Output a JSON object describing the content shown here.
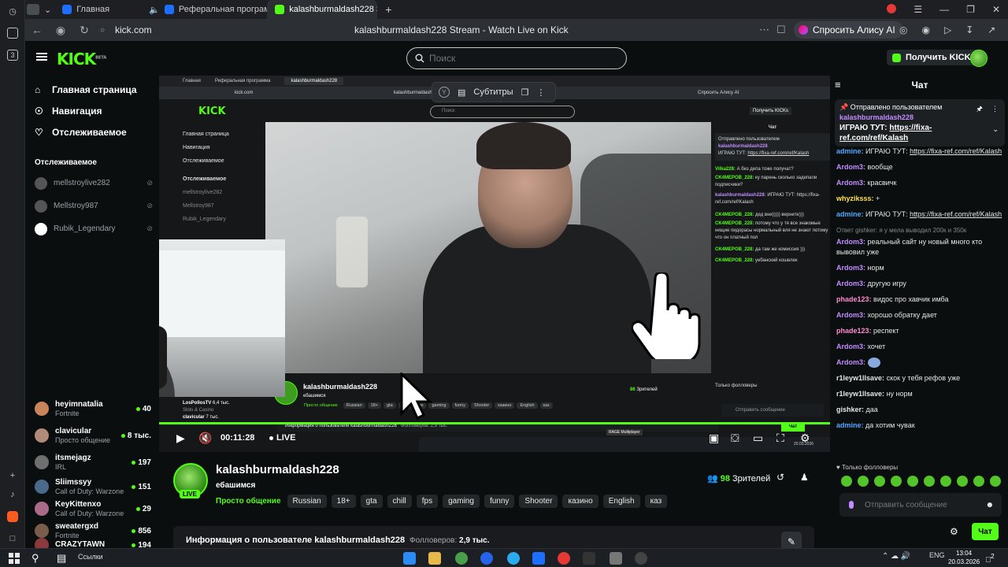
{
  "browser": {
    "tabs": [
      {
        "label": "Главная",
        "color": "#1e6fff"
      },
      {
        "label": "Реферальная программа",
        "color": "#1e6fff"
      },
      {
        "label": "kalashburmaldash228 S",
        "color": "#53fc18"
      }
    ],
    "url": "kick.com",
    "page_title": "kalashburmaldash228 Stream - Watch Live on Kick",
    "alice_label": "Спросить Алису AI",
    "rail_badge": "3"
  },
  "kick": {
    "logo": "KICK",
    "logo_sup": "BETA",
    "search_placeholder": "Поиск",
    "get_kicks": "Получить KICKs",
    "accent": "#53fc18"
  },
  "sidebar": {
    "links": [
      {
        "label": "Главная страница",
        "icon": "home-icon"
      },
      {
        "label": "Навигация",
        "icon": "compass-icon"
      },
      {
        "label": "Отслеживаемое",
        "icon": "heart-icon"
      }
    ],
    "followed_heading": "Отслеживаемое",
    "offline": [
      {
        "name": "mellstroylive282"
      },
      {
        "name": "Mellstroy987"
      },
      {
        "name": "Rubik_Legendary"
      }
    ],
    "live": [
      {
        "name": "heyimnatalia",
        "category": "Fortnite",
        "viewers": "40",
        "color": "#c9845b"
      },
      {
        "name": "clavicular",
        "category": "Просто общение",
        "viewers": "8 тыс.",
        "color": "#b08b77"
      },
      {
        "name": "itsmejagz",
        "category": "IRL",
        "viewers": "197",
        "color": "#6f6f6f"
      },
      {
        "name": "Sliimssyy",
        "category": "Call of Duty: Warzone",
        "viewers": "151",
        "color": "#4a6a8a"
      },
      {
        "name": "KeyKittenxo",
        "category": "Call of Duty: Warzone",
        "viewers": "29",
        "color": "#aa6b8b"
      },
      {
        "name": "sweatergxd",
        "category": "Fortnite",
        "viewers": "856",
        "color": "#7a5c4a"
      },
      {
        "name": "CRAZYTAWN",
        "category": "",
        "viewers": "194",
        "color": "#8a3a3a"
      }
    ]
  },
  "player": {
    "subtitles_label": "Субтитры",
    "timecode": "00:11:28",
    "live_label": "LIVE",
    "progress": 1.0
  },
  "inner": {
    "tabs": [
      "Главная",
      "Реферальная программа",
      "kalashburmaldash228"
    ],
    "url": "kick.com",
    "title": "kalashburmaldash228",
    "alice": "Спросить Алису AI",
    "search": "Поиск",
    "kicks": "Получить KICKs",
    "side": [
      "Главная страница",
      "Навигация",
      "Отслеживаемое"
    ],
    "side_heading": "Отслеживаемое",
    "side_ch": [
      "mellstroylive282",
      "Mellstroy987",
      "Rubik_Legendary"
    ],
    "side_live": [
      "LosPollosTV",
      "clavicular"
    ],
    "side_live_cat": "Slots & Casino",
    "side_live_views": [
      "6,4 тыс.",
      "7 тыс."
    ],
    "chat_title": "Чат",
    "pin_heading": "Отправлено пользователем",
    "pin_user": "kalashburmaldash228",
    "pin_text": "ИГРАЮ ТУТ:",
    "pin_link": "https://fixa-ref.com/ref/Kalash",
    "chat": [
      {
        "user": "Vilka228:",
        "text": "А без депа тоже получат?"
      },
      {
        "user": "CK4MEPOB_228:",
        "text": "ку парень сколько задепали подписчики?"
      },
      {
        "user": "kalashburmaldash228:",
        "text": "ИГРАЮ ТУТ: https://fixa-ref.com/ref/Kalash"
      },
      {
        "user": "CK4MEPOB_228:",
        "text": "дед вни))))) верните)))"
      },
      {
        "user": "CK4MEPOB_228:",
        "text": "потому что у тя все знакомые нищие пидорасы нормальный вля не знают потому что он платный пол"
      },
      {
        "user": "CK4MEPOB_228:",
        "text": "да там же комиссия )))"
      },
      {
        "user": "CK4MEPOB_228:",
        "text": "уебанский кошелек"
      }
    ],
    "followers_only": "Только фолловеры",
    "send_placeholder": "Отправить сообщение",
    "channel": "kalashburmaldash228",
    "channel_sub": "ебашимся",
    "viewers": "86",
    "viewers_label": "Зрителей",
    "tags": [
      "Просто общение",
      "Russian",
      "18+",
      "gta",
      "chill",
      "fps",
      "gaming",
      "funny",
      "Shooter",
      "казино",
      "English",
      "каз"
    ],
    "about": "Информация о пользователе kalashburmaldash228",
    "followers": "Фолловеров: 2,9 тыс.",
    "chat_btn": "Чат",
    "rage": "RAGE Multiplayer",
    "date": "20.03.2026"
  },
  "channel": {
    "name": "kalashburmaldash228",
    "subtitle": "ебашимся",
    "live_badge": "LIVE",
    "category": "Просто общение",
    "tags": [
      "Russian",
      "18+",
      "gta",
      "chill",
      "fps",
      "gaming",
      "funny",
      "Shooter",
      "казино",
      "English",
      "каз"
    ],
    "viewers_count": "98",
    "viewers_label": "Зрителей",
    "about_title": "Информация о пользователе kalashburmaldash228",
    "followers_label": "Фолловеров:",
    "followers_value": "2,9 тыс."
  },
  "chat": {
    "title": "Чат",
    "pinned_heading": "Отправлено пользователем",
    "pinned_user": "kalashburmaldash228",
    "pinned_text": "ИГРАЮ ТУТ:",
    "pinned_link": "https://fixa-ref.com/ref/Kalash",
    "messages": [
      {
        "user": "admine:",
        "color": "#53a8ff",
        "text": "ИГРАЮ ТУТ:",
        "link": "https://fixa-ref.com/ref/Kalash"
      },
      {
        "user": "Ardom3:",
        "color": "#c18cff",
        "text": "вообще"
      },
      {
        "user": "Ardom3:",
        "color": "#c18cff",
        "text": "красвичк"
      },
      {
        "user": "whyziksss:",
        "color": "#ffe04a",
        "text": "+"
      },
      {
        "user": "admine:",
        "color": "#53a8ff",
        "text": "ИГРАЮ ТУТ:",
        "link": "https://fixa-ref.com/ref/Kalash"
      },
      {
        "reply": "Ответ gishker: я у мела выводил 200к и 350к"
      },
      {
        "user": "Ardom3:",
        "color": "#c18cff",
        "text": "реальный сайт ну новый много кто вывовил уже"
      },
      {
        "user": "Ardom3:",
        "color": "#c18cff",
        "text": "норм"
      },
      {
        "user": "Ardom3:",
        "color": "#c18cff",
        "text": "другую игру"
      },
      {
        "user": "phade123:",
        "color": "#ff8ad1",
        "text": "видос про хавчик имба"
      },
      {
        "user": "Ardom3:",
        "color": "#c18cff",
        "text": "хорошо обратку дает"
      },
      {
        "user": "phade123:",
        "color": "#ff8ad1",
        "text": "респект"
      },
      {
        "user": "Ardom3:",
        "color": "#c18cff",
        "text": "хочет"
      },
      {
        "user": "Ardom3:",
        "color": "#c18cff",
        "text": ""
      },
      {
        "user": "r1leyw1llsave:",
        "color": "#ffffff",
        "text": "скок у тебя рефов уже"
      },
      {
        "user": "r1leyw1llsave:",
        "color": "#ffffff",
        "text": "ну норм"
      },
      {
        "user": "gishker:",
        "color": "#ffffff",
        "text": "даа"
      },
      {
        "user": "admine:",
        "color": "#53a8ff",
        "text": "да хотим чувак"
      }
    ],
    "followers_only": "Только фолловеры",
    "input_placeholder": "Отправить сообщение",
    "send_label": "Чат"
  },
  "taskbar": {
    "search": "Ссылки",
    "lang": "ENG",
    "time": "13:04",
    "date": "20.03.2026",
    "notif": "2"
  }
}
